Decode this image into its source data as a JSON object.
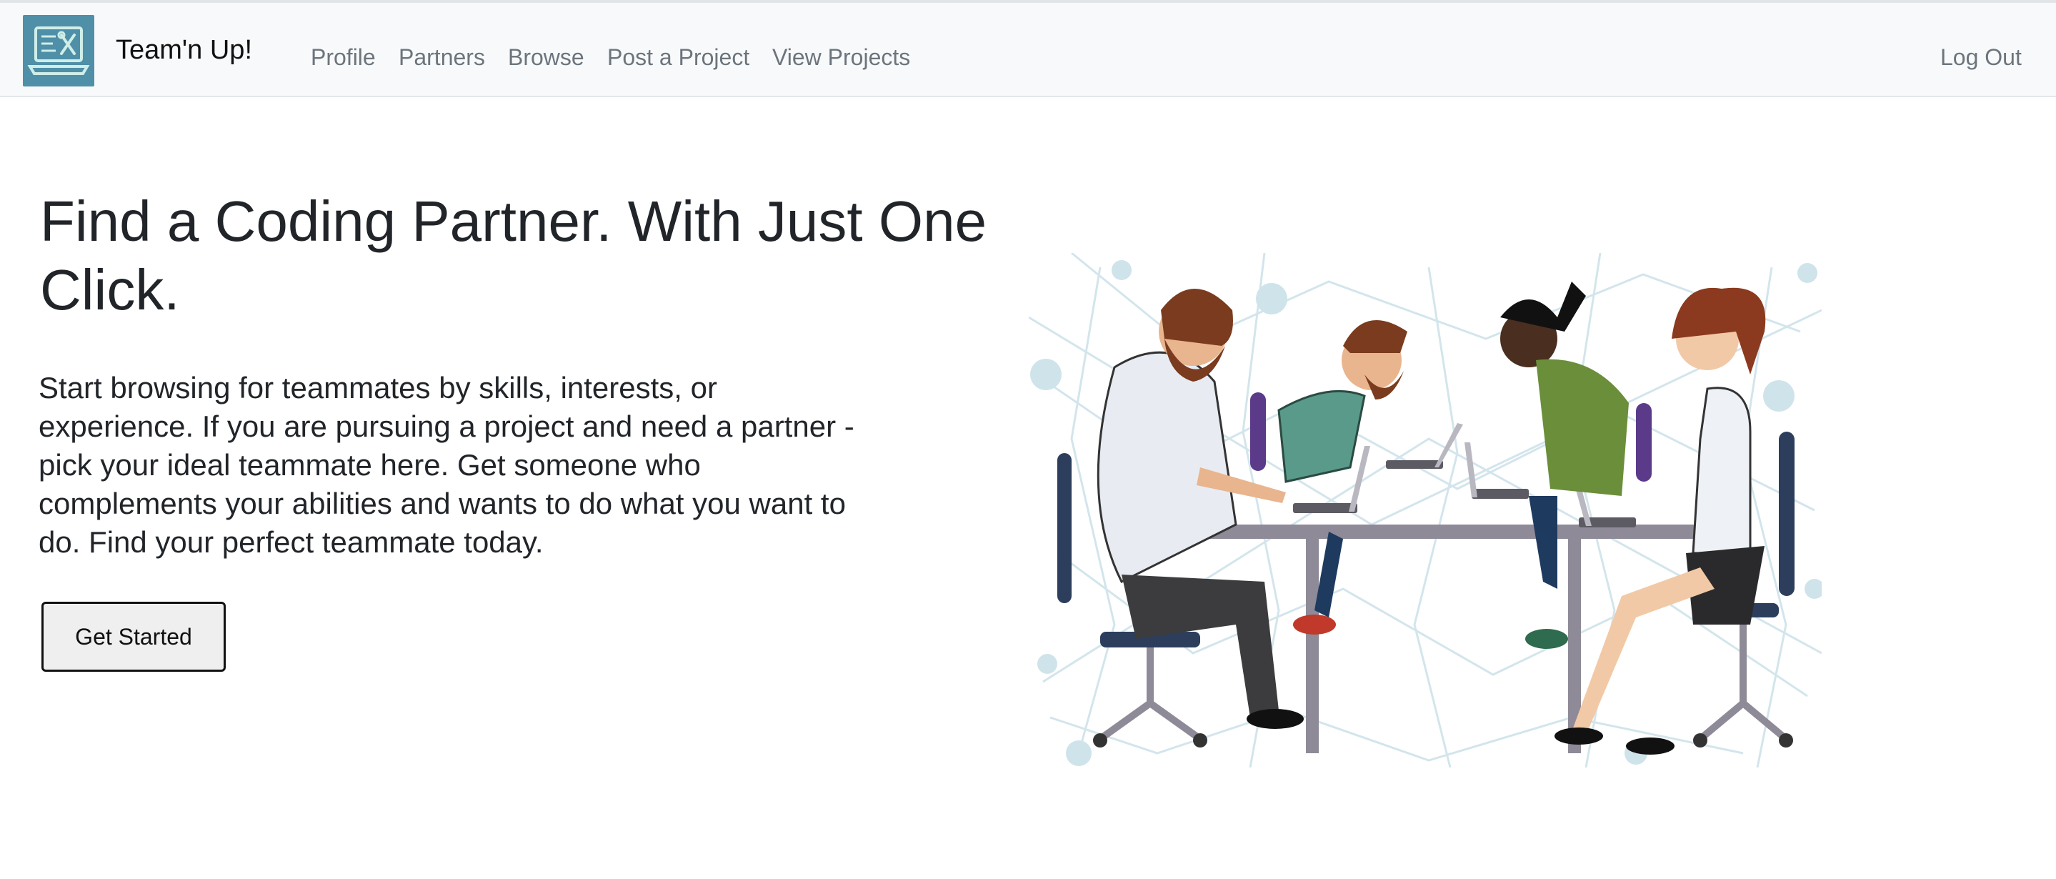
{
  "nav": {
    "brand": "Team'n Up!",
    "links": [
      "Profile",
      "Partners",
      "Browse",
      "Post a Project",
      "View Projects"
    ],
    "logout": "Log Out"
  },
  "hero": {
    "title": "Find a Coding Partner. With Just One Click.",
    "description": "Start browsing for teammates by skills, interests, or experience. If you are pursuing a project and need a partner - pick your ideal teammate here. Get someone who complements your abilities and wants to do what you want to do. Find your perfect teammate today.",
    "cta_label": "Get Started"
  },
  "colors": {
    "logo_bg": "#4f8fa8",
    "navbar_bg": "#f8f9fa",
    "nav_link": "#6c757d",
    "button_bg": "#efefef"
  },
  "icons": [
    "laptop-tools-logo-icon"
  ]
}
